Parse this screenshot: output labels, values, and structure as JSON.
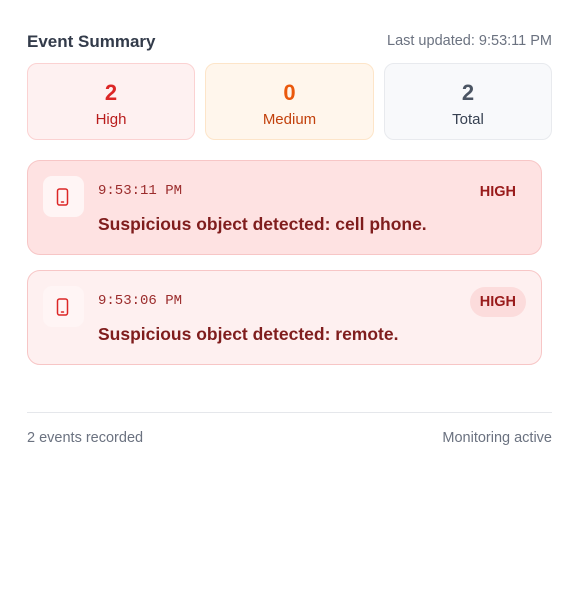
{
  "header": {
    "title": "Event Summary",
    "last_updated": "Last updated: 9:53:11 PM"
  },
  "stats": {
    "high": {
      "value": "2",
      "label": "High"
    },
    "medium": {
      "value": "0",
      "label": "Medium"
    },
    "total": {
      "value": "2",
      "label": "Total"
    }
  },
  "events": [
    {
      "time": "9:53:11 PM",
      "severity": "HIGH",
      "message": "Suspicious object detected: cell phone.",
      "icon": "phone-icon"
    },
    {
      "time": "9:53:06 PM",
      "severity": "HIGH",
      "message": "Suspicious object detected: remote.",
      "icon": "phone-icon"
    }
  ],
  "footer": {
    "count": "2 events recorded",
    "status": "Monitoring active"
  },
  "colors": {
    "high": "#dc2626",
    "medium": "#ea580c",
    "total": "#4b5563",
    "event_bg": "#fee2e2"
  }
}
